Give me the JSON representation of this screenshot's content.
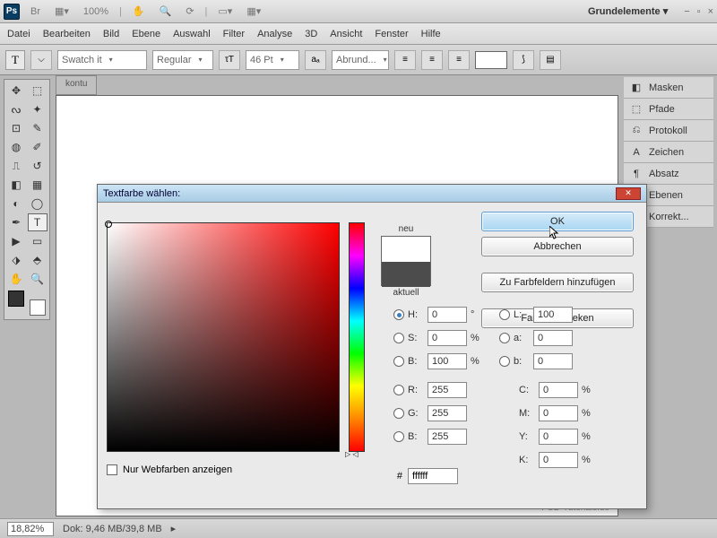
{
  "titlebar": {
    "zoom": "100%",
    "workspace": "Grundelemente ▾"
  },
  "menu": [
    "Datei",
    "Bearbeiten",
    "Bild",
    "Ebene",
    "Auswahl",
    "Filter",
    "Analyse",
    "3D",
    "Ansicht",
    "Fenster",
    "Hilfe"
  ],
  "optbar": {
    "font": "Swatch it",
    "style": "Regular",
    "size": "46 Pt",
    "aa": "Abrund..."
  },
  "doc_tab": "kontu",
  "panels": [
    {
      "icon": "◧",
      "label": "Masken"
    },
    {
      "icon": "⬚",
      "label": "Pfade"
    },
    {
      "icon": "⎌",
      "label": "Protokoll"
    },
    {
      "icon": "A",
      "label": "Zeichen"
    },
    {
      "icon": "¶",
      "label": "Absatz"
    },
    {
      "icon": "◈",
      "label": "Ebenen"
    },
    {
      "icon": "◑",
      "label": "Korrekt..."
    }
  ],
  "status": {
    "zoom": "18,82%",
    "dok": "Dok: 9,46 MB/39,8 MB"
  },
  "dialog": {
    "title": "Textfarbe wählen:",
    "new": "neu",
    "current": "aktuell",
    "buttons": {
      "ok": "OK",
      "cancel": "Abbrechen",
      "add": "Zu Farbfeldern hinzufügen",
      "libs": "Farbbibliotheken"
    },
    "hsb": {
      "h": "0",
      "s": "0",
      "b": "100"
    },
    "rgb": {
      "r": "255",
      "g": "255",
      "b": "255"
    },
    "lab": {
      "l": "100",
      "a": "0",
      "b": "0"
    },
    "cmyk": {
      "c": "0",
      "m": "0",
      "y": "0",
      "k": "0"
    },
    "deg": "°",
    "pct": "%",
    "hex": "ffffff",
    "webonly": "Nur Webfarben anzeigen"
  },
  "watermark": "PSD-Tutorials.de"
}
